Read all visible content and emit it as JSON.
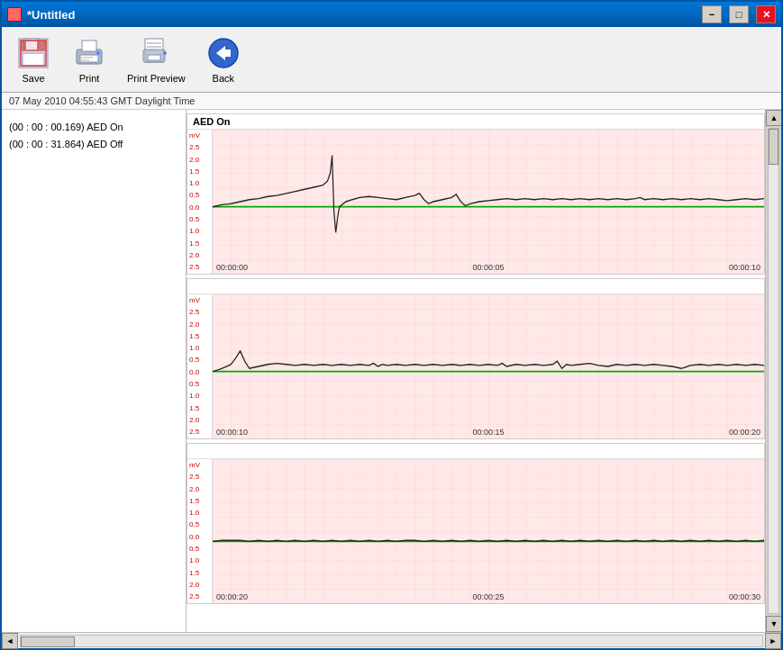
{
  "window": {
    "title": "*Untitled",
    "title_icon": "app-icon"
  },
  "toolbar": {
    "buttons": [
      {
        "id": "save",
        "label": "Save",
        "icon": "save-icon"
      },
      {
        "id": "print",
        "label": "Print",
        "icon": "print-icon"
      },
      {
        "id": "print-preview",
        "label": "Print Preview",
        "icon": "print-preview-icon"
      },
      {
        "id": "back",
        "label": "Back",
        "icon": "back-icon"
      }
    ]
  },
  "status": {
    "timestamp": "07 May 2010 04:55:43 GMT Daylight Time"
  },
  "events": [
    {
      "time": "(00 : 00 : 00.169)",
      "label": "AED On"
    },
    {
      "time": "(00 : 00 : 31.864)",
      "label": "AED Off"
    }
  ],
  "ecg_sections": [
    {
      "id": "section1",
      "header": "AED On",
      "scale_labels": [
        "mV",
        "2.5",
        "2.0",
        "1.5",
        "1.0",
        "0.5",
        "0.0",
        "0.5",
        "1.0",
        "1.5",
        "2.0",
        "2.5"
      ],
      "timeline": [
        "00:00:00",
        "00:00:05",
        "00:00:10"
      ]
    },
    {
      "id": "section2",
      "header": "",
      "scale_labels": [
        "mV",
        "2.5",
        "2.0",
        "1.5",
        "1.0",
        "0.5",
        "0.0",
        "0.5",
        "1.0",
        "1.5",
        "2.0",
        "2.5"
      ],
      "timeline": [
        "00:00:10",
        "00:00:15",
        "00:00:20"
      ]
    },
    {
      "id": "section3",
      "header": "",
      "scale_labels": [
        "mV",
        "2.5",
        "2.0",
        "1.5",
        "1.0",
        "0.5",
        "0.0",
        "0.5",
        "1.0",
        "1.5",
        "2.0",
        "2.5"
      ],
      "timeline": [
        "00:00:20",
        "00:00:25",
        "00:00:30"
      ]
    }
  ]
}
